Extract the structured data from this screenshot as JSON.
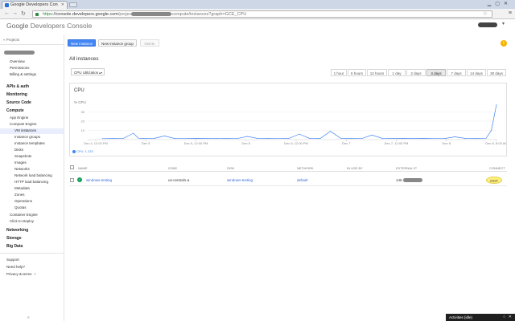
{
  "browser": {
    "tab_title": "Google Developers Con",
    "url_scheme": "https",
    "url_host": "://console.developers.google.com",
    "url_path_start": "/projec",
    "url_path_end": "compute/instances?graph=GCE_CPU",
    "icons": [
      "back-arrow-icon",
      "forward-arrow-icon",
      "reload-icon",
      "lock-icon",
      "star-icon",
      "menu-icon"
    ]
  },
  "header": {
    "logo_google": "Google",
    "logo_product": "Developers Console"
  },
  "sidebar": {
    "projects_label": "« Projects",
    "project_items": [
      "Overview",
      "Permissions",
      "Billing & settings"
    ],
    "sections": {
      "apis": "APIs & auth",
      "monitoring": "Monitoring",
      "source": "Source Code",
      "compute": "Compute"
    },
    "compute_items": [
      "App Engine",
      "Compute Engine"
    ],
    "compute_engine_items": [
      "VM instances",
      "Instance groups",
      "Instance templates",
      "Disks",
      "Snapshots",
      "Images",
      "Networks",
      "Network load balancing",
      "HTTP load balancing",
      "Metadata",
      "Zones",
      "Operations",
      "Quotas"
    ],
    "compute_tail": [
      "Container Engine",
      "Click to Deploy"
    ],
    "sections2": [
      "Networking",
      "Storage",
      "Big Data"
    ],
    "footer": [
      "Support",
      "Need help?",
      "Privacy & terms"
    ],
    "collapse": "«"
  },
  "actions": {
    "new_instance": "New instance",
    "new_instance_group": "New instance group",
    "delete": "Delete"
  },
  "page_title": "All instances",
  "metric_select": "CPU Utilization",
  "time_ranges": [
    "1 hour",
    "6 hours",
    "12 hours",
    "1 day",
    "2 days",
    "4 days",
    "7 days",
    "14 days",
    "30 days"
  ],
  "selected_time_range": "4 days",
  "chart": {
    "title": "CPU",
    "ylabel": "% CPU",
    "legend": "CPU: 1.233"
  },
  "chart_data": {
    "type": "line",
    "title": "CPU",
    "ylabel": "% CPU",
    "ylim": [
      0,
      40
    ],
    "yticks": [
      10,
      20,
      30
    ],
    "xticks": [
      "Dec 4, 12:00 PM",
      "Dec 5",
      "Dec 5, 12:00 PM",
      "Dec 6",
      "Dec 6, 12:00 PM",
      "Dec 7",
      "Dec 7, 12:00 PM",
      "Dec 8",
      "Dec 8, 8:03 AM"
    ],
    "series": [
      {
        "name": "CPU",
        "x": [
          0,
          0.1,
          0.2,
          0.3,
          0.35,
          0.4,
          0.5,
          0.6,
          0.7,
          0.8,
          0.9,
          1.0,
          1.1,
          1.2,
          1.3,
          1.4,
          1.5,
          1.6,
          1.7,
          1.8,
          1.9,
          2.0,
          2.1,
          2.2,
          2.3,
          2.4,
          2.5,
          2.6,
          2.7,
          2.8,
          2.9,
          3.0,
          3.1,
          3.2,
          3.3,
          3.4,
          3.5,
          3.6,
          3.7,
          3.75,
          3.8
        ],
        "values": [
          1,
          1.2,
          1.1,
          7,
          1.5,
          1.2,
          1.3,
          4,
          1.2,
          1.1,
          1.3,
          1.2,
          1.5,
          1.2,
          1.1,
          3.5,
          1.3,
          1.2,
          1.1,
          1.4,
          6,
          1.3,
          1.2,
          9,
          1.4,
          1.2,
          1.1,
          5,
          1.3,
          1.2,
          1.4,
          1.2,
          1.3,
          1.1,
          1.2,
          3,
          1.3,
          1.2,
          1.5,
          10,
          38
        ]
      }
    ]
  },
  "table": {
    "headers": [
      "NAME",
      "ZONE",
      "DISK",
      "NETWORK",
      "IN USE BY",
      "EXTERNAL IP",
      "CONNECT"
    ],
    "row": {
      "name": "windows-testing",
      "zone": "us-central1-a",
      "disk": "windows-testing",
      "network": "default",
      "in_use_by": "",
      "external_ip_prefix": "146.",
      "connect": "RDP"
    }
  },
  "activities": {
    "label": "Activities (idle)",
    "icons": [
      "refresh-icon",
      "close-icon"
    ]
  },
  "info_icon_glyph": "!"
}
